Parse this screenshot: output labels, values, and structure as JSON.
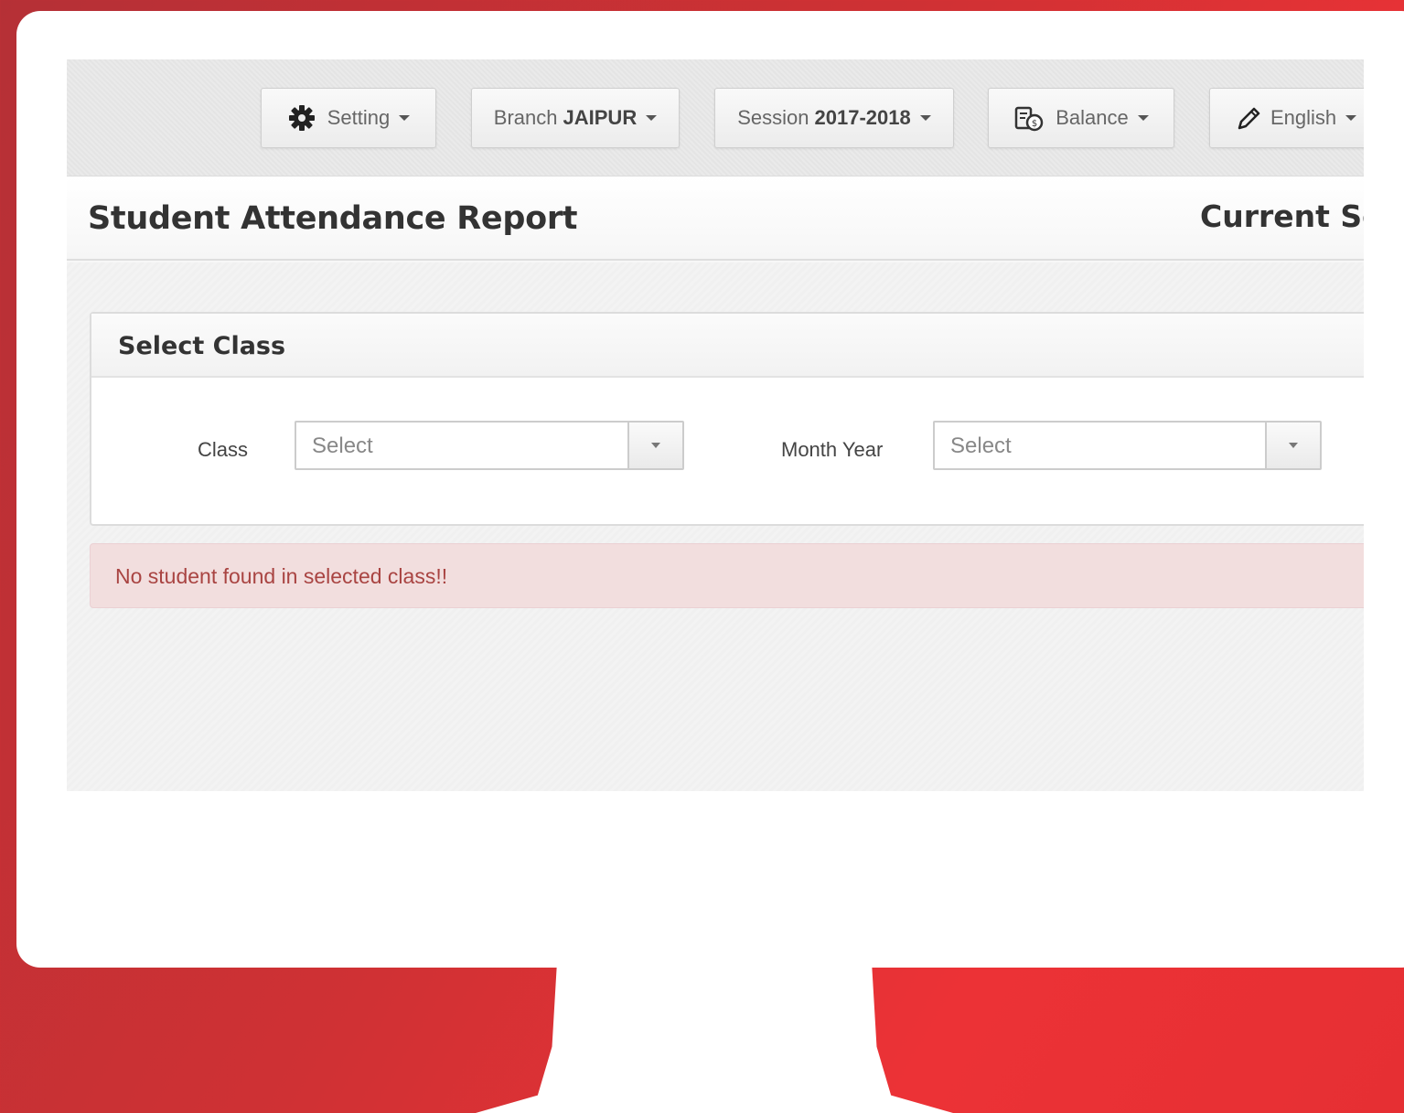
{
  "toolbar": {
    "setting": {
      "label": "Setting",
      "icon": "gear-icon"
    },
    "branch": {
      "prefix": "Branch",
      "value": "JAIPUR"
    },
    "session": {
      "prefix": "Session",
      "value": "2017-2018"
    },
    "balance": {
      "label": "Balance",
      "icon": "balance-icon"
    },
    "language": {
      "label": "English",
      "icon": "pencil-icon"
    }
  },
  "header": {
    "title": "Student Attendance Report",
    "current_session": "Current Se"
  },
  "panel": {
    "title": "Select Class",
    "class_field": {
      "label": "Class",
      "value": "Select"
    },
    "month_year_field": {
      "label": "Month Year",
      "value": "Select"
    }
  },
  "alert": {
    "message": "No student found in selected class!!"
  },
  "colors": {
    "brand_red": "#d23236",
    "alert_bg": "#f2dede",
    "alert_text": "#a94442"
  }
}
